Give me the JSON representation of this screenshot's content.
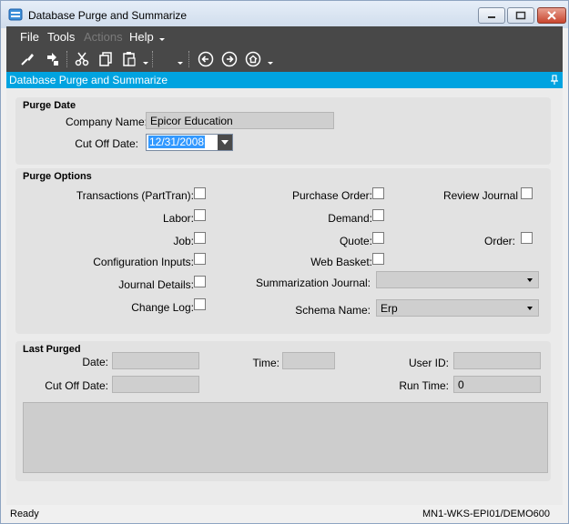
{
  "window": {
    "title": "Database Purge and Summarize"
  },
  "menu": {
    "file": "File",
    "tools": "Tools",
    "actions": "Actions",
    "help": "Help"
  },
  "toolbar": {
    "icons": [
      "clear-icon",
      "save-icon",
      "cut-icon",
      "copy-icon",
      "paste-icon",
      "back-icon",
      "forward-icon",
      "home-icon"
    ]
  },
  "form": {
    "header": "Database Purge and Summarize"
  },
  "purge_date": {
    "title": "Purge Date",
    "company_label": "Company Name:",
    "company_value": "Epicor Education",
    "cutoff_label": "Cut Off Date:",
    "cutoff_value": "12/31/2008"
  },
  "purge_options": {
    "title": "Purge Options",
    "transactions": "Transactions (PartTran):",
    "purchase_order": "Purchase Order:",
    "review_journal": "Review Journal",
    "labor": "Labor:",
    "demand": "Demand:",
    "job": "Job:",
    "quote": "Quote:",
    "order": "Order:",
    "configuration_inputs": "Configuration Inputs:",
    "web_basket": "Web Basket:",
    "journal_details": "Journal Details:",
    "summarization_journal": "Summarization Journal:",
    "summarization_value": "",
    "change_log": "Change Log:",
    "schema_label": "Schema Name:",
    "schema_value": "Erp"
  },
  "last_purged": {
    "title": "Last Purged",
    "date_label": "Date:",
    "date_value": "",
    "time_label": "Time:",
    "time_value": "",
    "userid_label": "User ID:",
    "userid_value": "",
    "cutoff_label": "Cut Off Date:",
    "cutoff_value": "",
    "runtime_label": "Run Time:",
    "runtime_value": "0"
  },
  "status": {
    "left": "Ready",
    "right": "MN1-WKS-EPI01/DEMO600"
  }
}
